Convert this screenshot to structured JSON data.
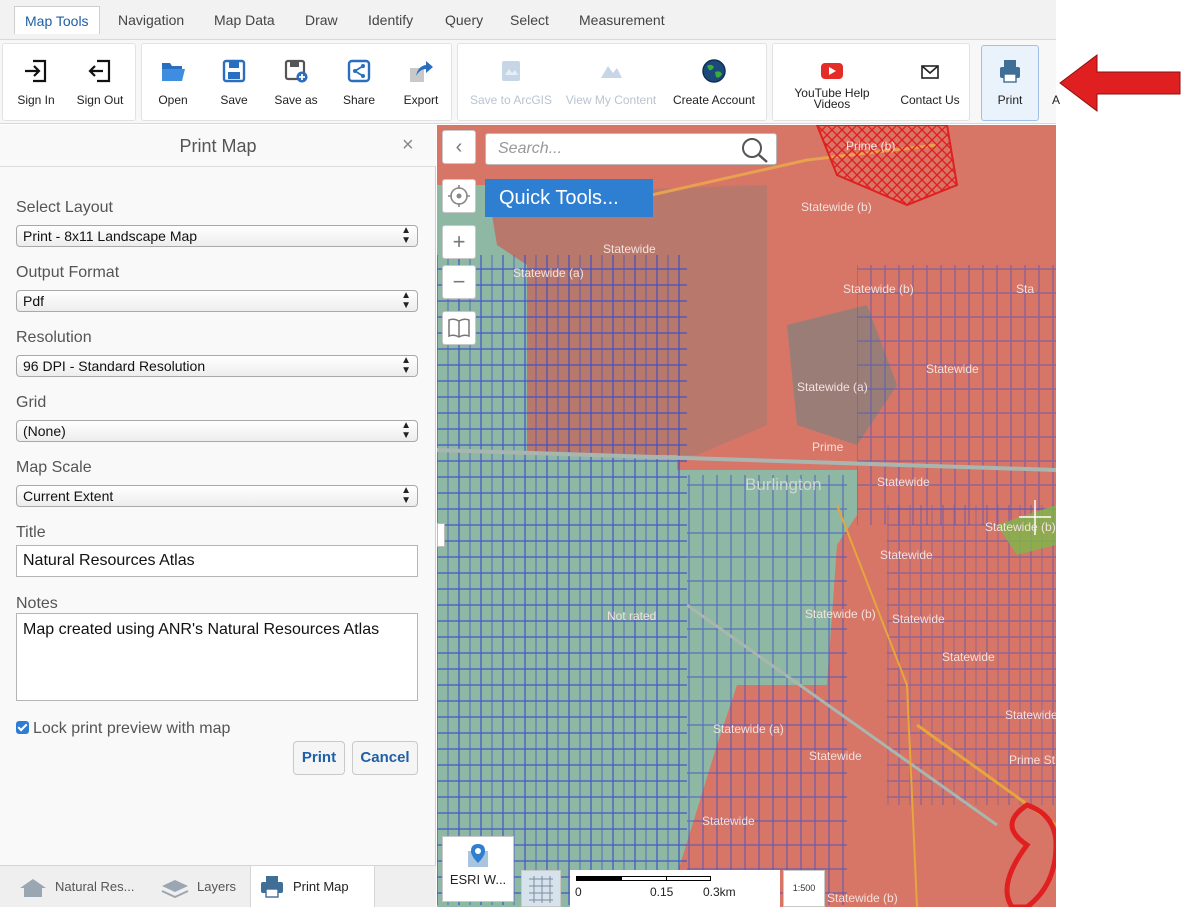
{
  "tabs": [
    "Map Tools",
    "Navigation",
    "Map Data",
    "Draw",
    "Identify",
    "Query",
    "Select",
    "Measurement"
  ],
  "toolbar": {
    "sign_in": "Sign In",
    "sign_out": "Sign Out",
    "open": "Open",
    "save": "Save",
    "save_as": "Save as",
    "share": "Share",
    "export": "Export",
    "save_to_arcgis": "Save to ArcGIS",
    "view_my_content": "View My Content",
    "create_account": "Create Account",
    "youtube_help_1": "YouTube Help",
    "youtube_help_2": "Videos",
    "contact_us": "Contact Us",
    "print": "Print",
    "cut_label": "A"
  },
  "panel": {
    "title": "Print Map",
    "close": "×",
    "layout_label": "Select Layout",
    "layout_value": "Print - 8x11 Landscape Map",
    "format_label": "Output Format",
    "format_value": "Pdf",
    "resolution_label": "Resolution",
    "resolution_value": "96 DPI - Standard Resolution",
    "grid_label": "Grid",
    "grid_value": "(None)",
    "scale_label": "Map Scale",
    "scale_value": "Current Extent",
    "title_label": "Title",
    "title_value": "Natural Resources Atlas",
    "notes_label": "Notes",
    "notes_value": "Map created using ANR's Natural Resources Atlas",
    "lock_label": "Lock print preview with map",
    "lock_checked": true,
    "print_button": "Print",
    "cancel_button": "Cancel"
  },
  "bottom_tabs": [
    "Natural Res...",
    "Layers",
    "Print Map"
  ],
  "map": {
    "search_placeholder": "Search...",
    "quick_tools": "Quick Tools...",
    "basemap_label": "ESRI W...",
    "scale_labels": [
      "0",
      "0.15",
      "0.3km"
    ],
    "scale_ratio": "1:500",
    "labels": [
      "Prime (b)",
      "Statewide (b)",
      "Statewide",
      "Statewide (a)",
      "Statewide (b)",
      "Statewide (b)",
      "Sta",
      "Statewide (a)",
      "Statewide",
      "Prime",
      "Burlington",
      "Statewide",
      "Statewide (b)",
      "Statewide",
      "Not rated",
      "Statewide (b)",
      "Statewide",
      "Statewide",
      "Statewide",
      "Statewide (a)",
      "Statewide",
      "Prime St",
      "Statewide",
      "Statewide (b)",
      "Statewide"
    ]
  },
  "colors": {
    "accent": "#2e7fd2",
    "arrow": "#e02020",
    "parcel_lines": "#3d4fc9",
    "farmland_red": "#d77566",
    "not_rated_green": "#8fb8a4"
  }
}
